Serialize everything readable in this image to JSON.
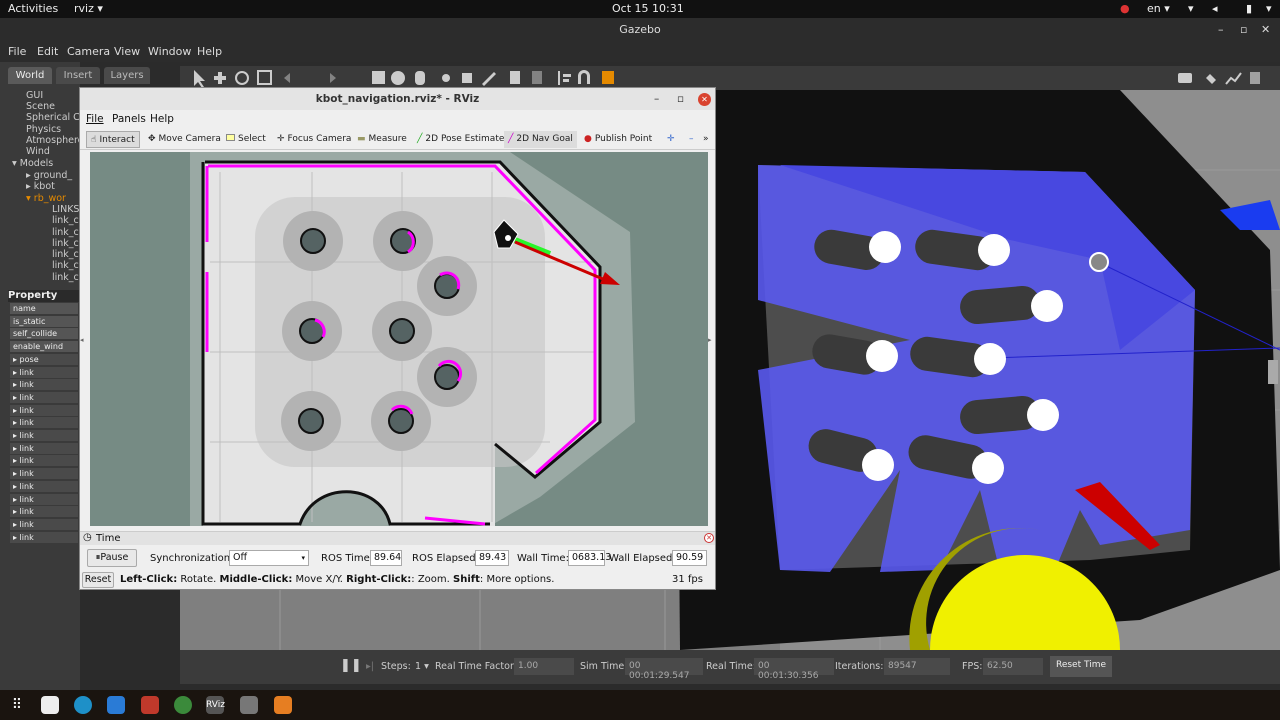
{
  "topbar": {
    "activities": "Activities",
    "app": "rviz ▾",
    "datetime": "Oct 15  10:31",
    "lang": "en ▾"
  },
  "gazebo": {
    "title": "Gazebo",
    "menu": [
      "File",
      "Edit",
      "Camera",
      "View",
      "Window",
      "Help"
    ],
    "tabs": [
      "World",
      "Insert",
      "Layers"
    ],
    "tree": [
      "GUI",
      "Scene",
      "Spherical Co",
      "Physics",
      "Atmosphere",
      "Wind",
      "▾ Models",
      "▸ ground_",
      "▸ kbot",
      "▾ rb_wor",
      "LINKS",
      "link_c",
      "link_c",
      "link_c",
      "link_c",
      "link_c",
      "link_c"
    ],
    "property_header": "Property",
    "property_rows": [
      "name",
      "is_static",
      "self_collide",
      "enable_wind",
      "▸ pose",
      "▸ link",
      "▸ link",
      "▸ link",
      "▸ link",
      "▸ link",
      "▸ link",
      "▸ link",
      "▸ link",
      "▸ link",
      "▸ link",
      "▸ link",
      "▸ link",
      "▸ link",
      "▸ link"
    ],
    "bottom": {
      "steps_label": "Steps:",
      "steps_value": "1 ▾",
      "rtf_label": "Real Time Factor:",
      "rtf_value": "1.00",
      "sim_label": "Sim Time:",
      "sim_value": "00 00:01:29.547",
      "real_label": "Real Time:",
      "real_value": "00 00:01:30.356",
      "iter_label": "Iterations:",
      "iter_value": "89547",
      "fps_label": "FPS:",
      "fps_value": "62.50",
      "reset_time": "Reset Time"
    }
  },
  "rviz": {
    "title": "kbot_navigation.rviz* - RViz",
    "menu": [
      "File",
      "Panels",
      "Help"
    ],
    "tools": [
      "Interact",
      "Move Camera",
      "Select",
      "Focus Camera",
      "Measure",
      "2D Pose Estimate",
      "2D Nav Goal",
      "Publish Point"
    ],
    "time_panel": {
      "header": "Time",
      "pause": "Pause",
      "sync_label": "Synchronization:",
      "sync_value": "Off",
      "ros_time_label": "ROS Time:",
      "ros_time": "89.64",
      "ros_elapsed_label": "ROS Elapsed:",
      "ros_elapsed": "89.43",
      "wall_time_label": "Wall Time:",
      "wall_time": "0683.13",
      "wall_elapsed_label": "Wall Elapsed:",
      "wall_elapsed": "90.59"
    },
    "status": {
      "reset": "Reset",
      "left": "Left-Click:",
      "left_t": " Rotate. ",
      "middle": "Middle-Click:",
      "middle_t": " Move X/Y. ",
      "right": "Right-Click:",
      "right_t": ": Zoom. ",
      "shift": "Shift",
      "shift_t": ": More options.",
      "fps": "31 fps"
    }
  },
  "colors": {
    "laser": "#ff00ff",
    "plan": "#00ff00",
    "goal": "#cc0000",
    "scan_gazebo": "#5a5af0",
    "yellow": "#f0f000"
  }
}
